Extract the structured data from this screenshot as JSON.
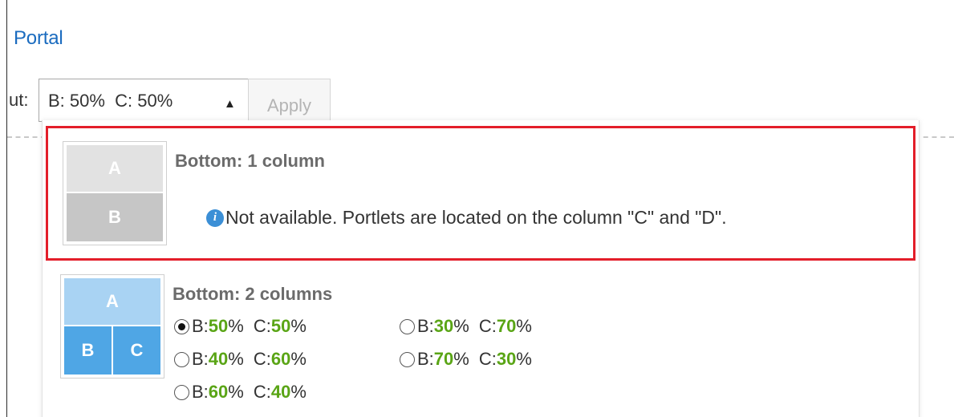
{
  "header": {
    "portal_link": "Portal"
  },
  "layout_row": {
    "label": "ut:",
    "selected_value": "B: 50%  C: 50%",
    "caret_icon": "caret-up-icon",
    "apply_label": "Apply"
  },
  "colors": {
    "link": "#1a6bbf",
    "highlight_border": "#e31e2a",
    "percent_green": "#5aa516",
    "thumb_blue_light": "#a9d3f3",
    "thumb_blue": "#4fa6e5",
    "thumb_gray_light": "#e2e2e2",
    "thumb_gray": "#c6c6c6",
    "info_blue": "#3b8fd6"
  },
  "options": [
    {
      "title": "Bottom: 1 column",
      "thumbnail": {
        "cells": [
          "A",
          "B"
        ],
        "state": "disabled"
      },
      "notice_icon": "info-icon",
      "notice": "Not available. Portlets are located on the column \"C\" and \"D\"."
    },
    {
      "title": "Bottom: 2 columns",
      "thumbnail": {
        "cells": [
          "A",
          "B",
          "C"
        ],
        "state": "enabled"
      },
      "radio_choices": [
        {
          "b_label": "B:",
          "b_pct": "50",
          "c_label": "C:",
          "c_pct": "50",
          "pct_sign": "%",
          "checked": true
        },
        {
          "b_label": "B:",
          "b_pct": "30",
          "c_label": "C:",
          "c_pct": "70",
          "pct_sign": "%",
          "checked": false
        },
        {
          "b_label": "B:",
          "b_pct": "40",
          "c_label": "C:",
          "c_pct": "60",
          "pct_sign": "%",
          "checked": false
        },
        {
          "b_label": "B:",
          "b_pct": "70",
          "c_label": "C:",
          "c_pct": "30",
          "pct_sign": "%",
          "checked": false
        },
        {
          "b_label": "B:",
          "b_pct": "60",
          "c_label": "C:",
          "c_pct": "40",
          "pct_sign": "%",
          "checked": false
        }
      ]
    }
  ]
}
